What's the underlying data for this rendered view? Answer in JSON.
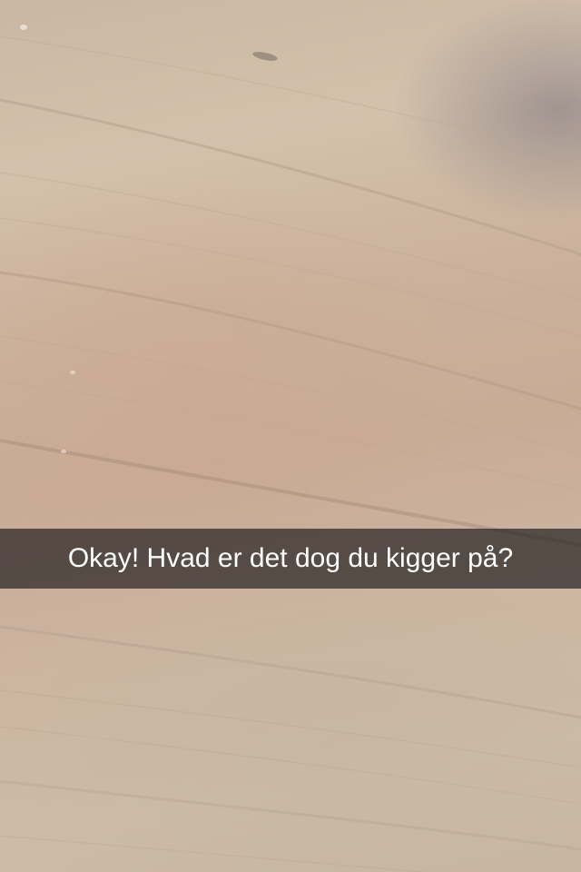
{
  "snap": {
    "caption": "Okay! Hvad er det dog du kigger på?"
  },
  "colors": {
    "wood_light": "#d4c1ac",
    "wood_mid": "#c9ab96",
    "shadow": "#7a737d",
    "caption_background": "#282424",
    "caption_text": "#ffffff"
  }
}
